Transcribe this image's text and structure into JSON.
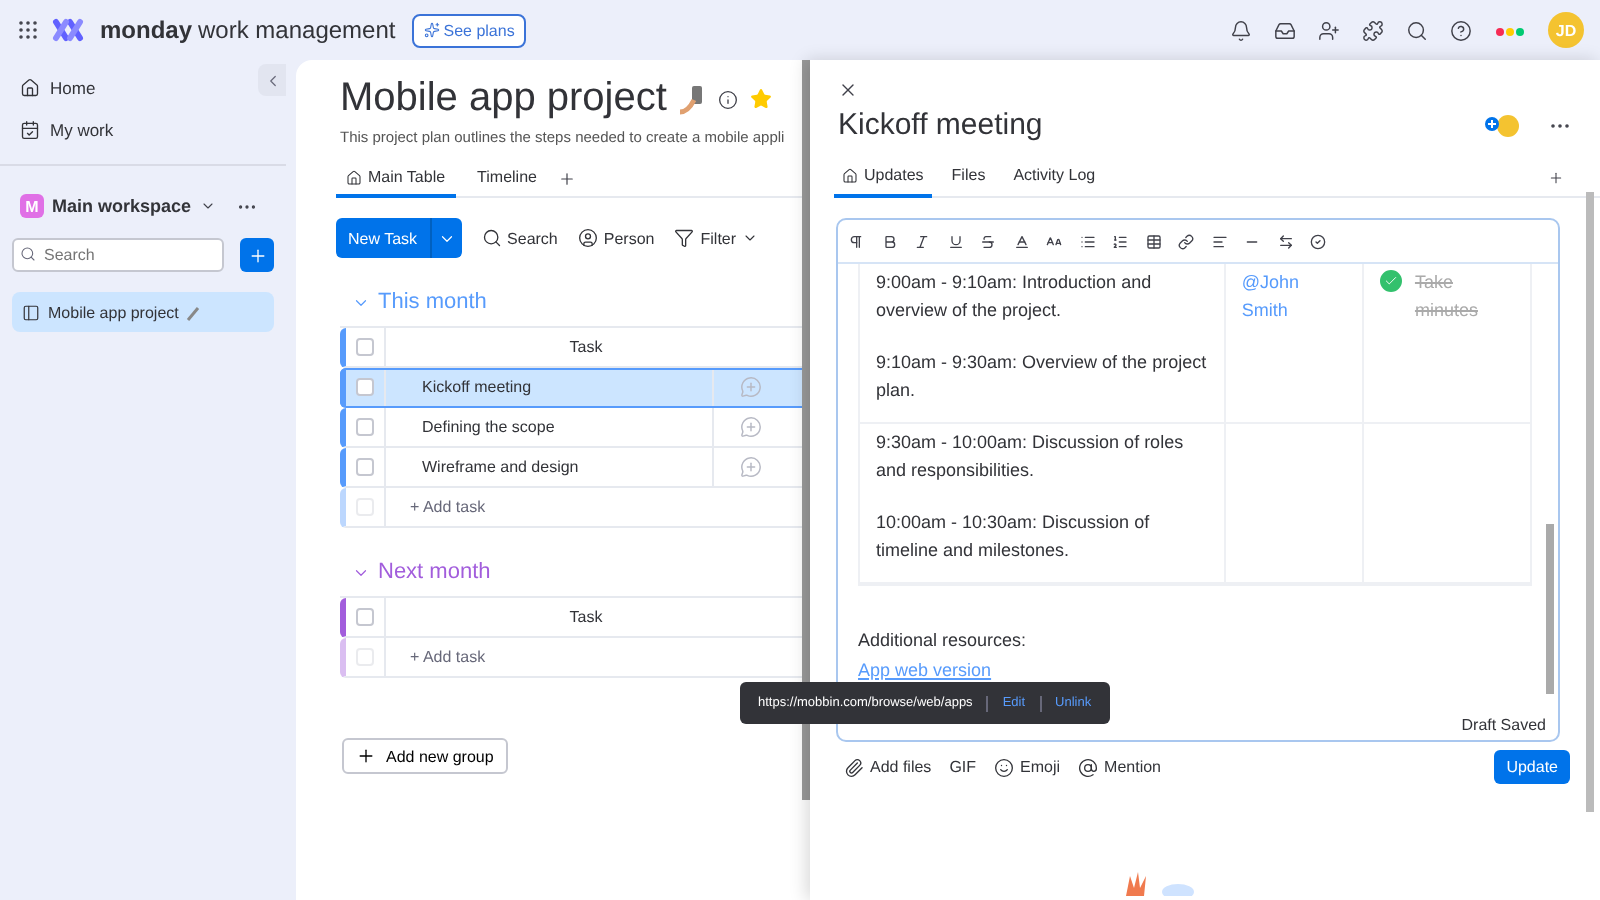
{
  "topbar": {
    "brand": "monday",
    "product": "work management",
    "see_plans": "See plans",
    "avatar": "JD"
  },
  "sidebar": {
    "nav": [
      {
        "label": "Home"
      },
      {
        "label": "My work"
      }
    ],
    "workspace": {
      "initial": "M",
      "name": "Main workspace"
    },
    "search": {
      "placeholder": "Search"
    },
    "boards": [
      {
        "label": "Mobile app project",
        "selected": true
      }
    ]
  },
  "board": {
    "title": "Mobile app project",
    "description": "This project plan outlines the steps needed to create a mobile appli",
    "views": [
      {
        "label": "Main Table",
        "selected": true
      },
      {
        "label": "Timeline",
        "selected": false
      }
    ],
    "new_task": "New Task",
    "actions": [
      {
        "label": "Search"
      },
      {
        "label": "Person"
      },
      {
        "label": "Filter"
      }
    ],
    "groups": [
      {
        "name": "This month",
        "color": "#579bfc",
        "column": "Task",
        "checked": false,
        "add_row": {
          "label": "+ Add task",
          "disabled": true
        },
        "rows": [
          {
            "name": "Kickoff meeting",
            "selected": true,
            "checked": false
          },
          {
            "name": "Defining the scope",
            "selected": false,
            "checked": false
          },
          {
            "name": "Wireframe and design",
            "selected": false,
            "checked": false
          }
        ]
      },
      {
        "name": "Next month",
        "color": "#a25ddc",
        "column": "Task",
        "checked": false,
        "add_row": {
          "label": "+ Add task",
          "disabled": true
        }
      }
    ],
    "add_group": "Add new group"
  },
  "panel": {
    "title": "Kickoff meeting",
    "tabs": [
      {
        "label": "Updates",
        "selected": true
      },
      {
        "label": "Files",
        "selected": false
      },
      {
        "label": "Activity Log",
        "selected": false
      }
    ],
    "rows": [
      {
        "agenda": [
          "9:00am - 9:10am: Introduction and overview of the project.",
          "9:10am - 9:30am: Overview of the project plan."
        ],
        "owner": "@John Smith",
        "todo": {
          "label": "Take minutes",
          "checked": true
        }
      },
      {
        "agenda": [
          "9:30am - 10:00am: Discussion of roles and responsibilities.",
          "10:00am - 10:30am: Discussion of timeline and milestones."
        ]
      }
    ],
    "resources_label": "Additional resources:",
    "link": "App web version",
    "draft": "Draft Saved",
    "actions": [
      {
        "label": "Add files"
      },
      {
        "label": "GIF"
      },
      {
        "label": "Emoji"
      },
      {
        "label": "Mention"
      }
    ],
    "update": "Update"
  },
  "tooltip": {
    "url": "https://mobbin.com/browse/web/apps",
    "edit": "Edit",
    "unlink": "Unlink"
  }
}
